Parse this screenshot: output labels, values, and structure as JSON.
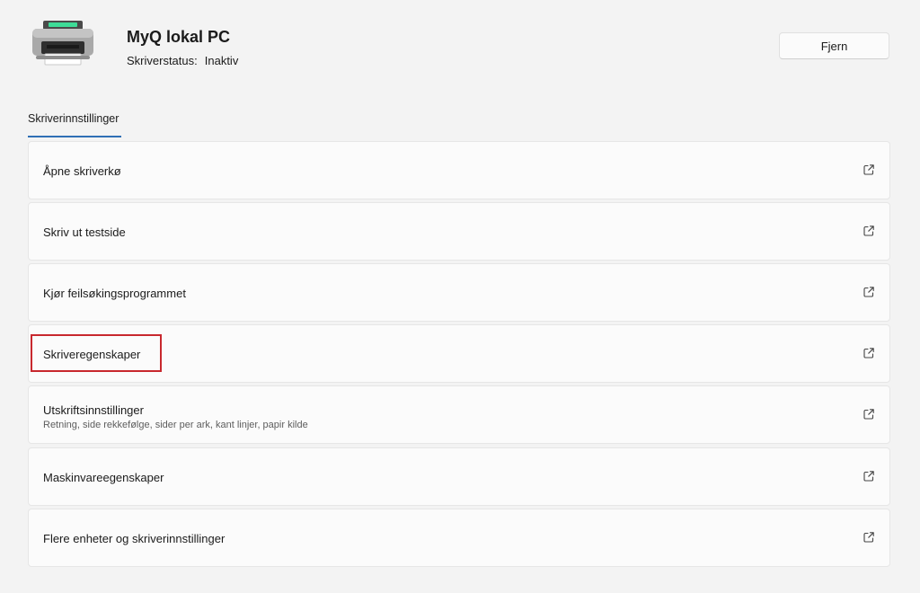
{
  "header": {
    "printer_name": "MyQ lokal PC",
    "status_label": "Skriverstatus:",
    "status_value": "Inaktiv",
    "remove_label": "Fjern",
    "printer_icon": "printer-icon"
  },
  "section": {
    "tab_label": "Skriverinnstillinger"
  },
  "items": [
    {
      "label": "Åpne skriverkø",
      "sublabel": "",
      "icon": "open-external-icon"
    },
    {
      "label": "Skriv ut testside",
      "sublabel": "",
      "icon": "open-external-icon"
    },
    {
      "label": "Kjør feilsøkingsprogrammet",
      "sublabel": "",
      "icon": "open-external-icon"
    },
    {
      "label": "Skriveregenskaper",
      "sublabel": "",
      "icon": "open-external-icon"
    },
    {
      "label": "Utskriftsinnstillinger",
      "sublabel": "Retning, side rekkefølge, sider per ark, kant linjer, papir kilde",
      "icon": "open-external-icon"
    },
    {
      "label": "Maskinvareegenskaper",
      "sublabel": "",
      "icon": "open-external-icon"
    },
    {
      "label": "Flere enheter og skriverinnstillinger",
      "sublabel": "",
      "icon": "open-external-icon"
    }
  ],
  "colors": {
    "accent": "#2f6fb5",
    "highlight": "#c8282e",
    "background": "#f3f3f3",
    "card": "#fbfbfb"
  }
}
